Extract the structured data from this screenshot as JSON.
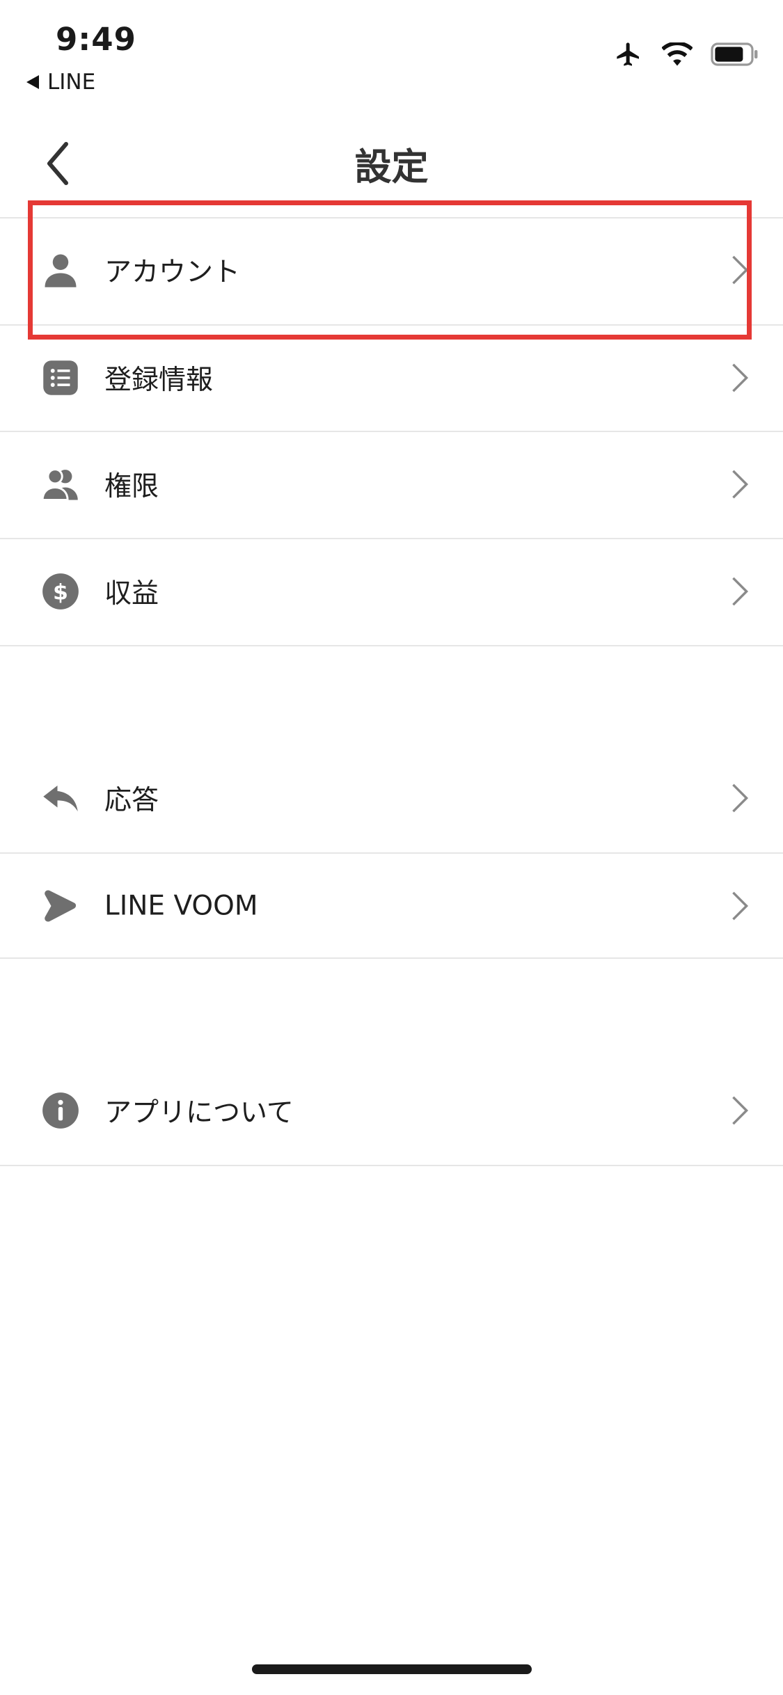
{
  "status_bar": {
    "time": "9:49",
    "back_app_label": "LINE",
    "icons": [
      "airplane-icon",
      "wifi-icon",
      "battery-icon"
    ]
  },
  "nav": {
    "title": "設定",
    "back_icon": "chevron-left-icon"
  },
  "settings": {
    "group1": [
      {
        "label": "アカウント",
        "icon": "person-icon",
        "highlighted": true
      },
      {
        "label": "登録情報",
        "icon": "list-icon"
      },
      {
        "label": "権限",
        "icon": "people-icon"
      },
      {
        "label": "収益",
        "icon": "dollar-icon"
      }
    ],
    "group2": [
      {
        "label": "応答",
        "icon": "reply-icon"
      },
      {
        "label": "LINE VOOM",
        "icon": "voom-icon"
      }
    ],
    "group3": [
      {
        "label": "アプリについて",
        "icon": "info-icon"
      }
    ]
  },
  "colors": {
    "highlight": "#e53935",
    "icon_gray": "#6f6f6f",
    "chevron": "#8a8a8a",
    "divider": "#e6e6e6"
  }
}
